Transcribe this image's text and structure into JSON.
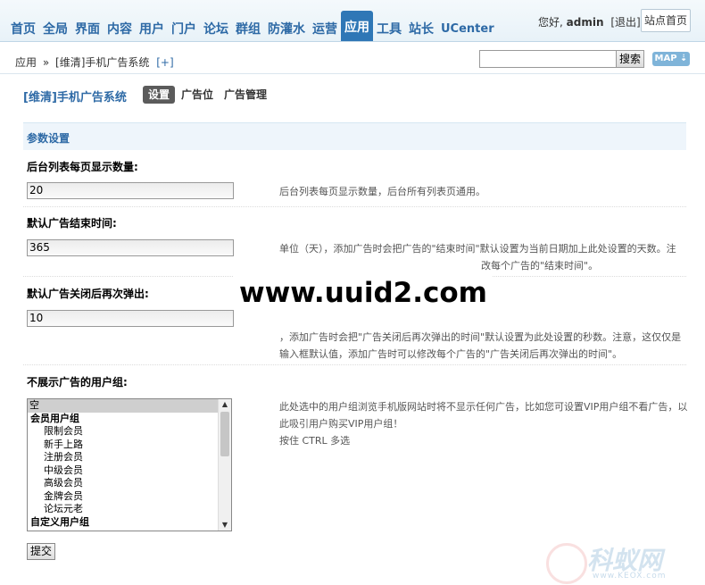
{
  "nav": {
    "items": [
      "首页",
      "全局",
      "界面",
      "内容",
      "用户",
      "门户",
      "论坛",
      "群组",
      "防灌水",
      "运营",
      "应用",
      "工具",
      "站长",
      "UCenter"
    ],
    "active": "应用"
  },
  "header": {
    "welcome": "您好,",
    "username": "admin",
    "logout": "[退出]",
    "site_home": "站点首页"
  },
  "breadcrumb": {
    "root": "应用",
    "sep": "»",
    "current": "[维清]手机广告系统",
    "add": "[+]"
  },
  "search": {
    "value": "",
    "button": "搜索",
    "map": "MAP ⇣"
  },
  "plugin": {
    "title": "[维清]手机广告系统",
    "tabs": [
      "设置",
      "广告位",
      "广告管理"
    ],
    "active_tab": "设置"
  },
  "section": {
    "title": "参数设置"
  },
  "settings": [
    {
      "label": "后台列表每页显示数量:",
      "value": "20",
      "desc": [
        "后台列表每页显示数量，后台所有列表页通用。"
      ]
    },
    {
      "label": "默认广告结束时间:",
      "value": "365",
      "desc": [
        "单位（天），添加广告时会把广告的\"结束时间\"默认设置为当前日期加上此处设置的天数。注",
        "改每个广告的\"结束时间\"。"
      ]
    },
    {
      "label": "默认广告关闭后再次弹出:",
      "value": "10",
      "desc": [
        "，添加广告时会把\"广告关闭后再次弹出的时间\"默认设置为此处设置的秒数。注意，这仅仅是",
        "输入框默认值，添加广告时可以修改每个广告的\"广告关闭后再次弹出的时间\"。"
      ]
    }
  ],
  "usergroups": {
    "label": "不展示广告的用户组:",
    "options": [
      {
        "text": "空",
        "kind": "sel"
      },
      {
        "text": "会员用户组",
        "kind": "group"
      },
      {
        "text": "限制会员",
        "kind": "sub"
      },
      {
        "text": "新手上路",
        "kind": "sub"
      },
      {
        "text": "注册会员",
        "kind": "sub"
      },
      {
        "text": "中级会员",
        "kind": "sub"
      },
      {
        "text": "高级会员",
        "kind": "sub"
      },
      {
        "text": "金牌会员",
        "kind": "sub"
      },
      {
        "text": "论坛元老",
        "kind": "sub"
      },
      {
        "text": "自定义用户组",
        "kind": "group"
      }
    ],
    "desc": [
      "此处选中的用户组浏览手机版网站时将不显示任何广告，比如您可设置VIP用户组不看广告，以",
      "此吸引用户购买VIP用户组！",
      "按住 CTRL 多选"
    ]
  },
  "submit": "提交",
  "watermark": "www.uuid2.com",
  "watermark2": {
    "big": "科蚁网",
    "small": "www.KEOX.com"
  },
  "colors": {
    "accent": "#2e6aa6",
    "nav_active_bg": "#2f77b6",
    "section_bg": "#eef5fb"
  }
}
